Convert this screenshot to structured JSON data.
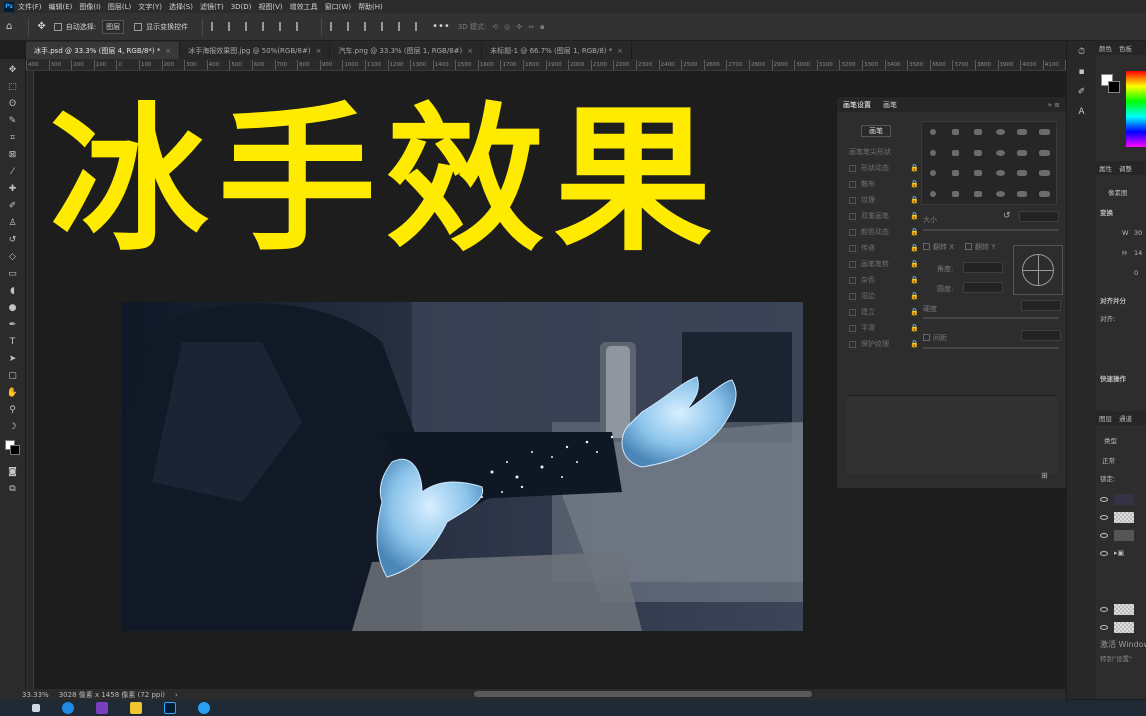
{
  "app": {
    "logo_text": "Ps"
  },
  "menu": [
    "文件(F)",
    "编辑(E)",
    "图像(I)",
    "图层(L)",
    "文字(Y)",
    "选择(S)",
    "滤镜(T)",
    "3D(D)",
    "视图(V)",
    "增效工具",
    "窗口(W)",
    "帮助(H)"
  ],
  "options_bar": {
    "auto_select_label": "自动选择:",
    "auto_select_value": "图层",
    "show_transform_label": "显示变换控件",
    "mode_label": "3D 模式:"
  },
  "tabs": [
    {
      "label": "冰手.psd @ 33.3% (图层 4, RGB/8*) *",
      "active": true
    },
    {
      "label": "冰手海报效果图.jpg @ 50%(RGB/8#)",
      "active": false
    },
    {
      "label": "汽车.png @ 33.3% (图层 1, RGB/8#)",
      "active": false
    },
    {
      "label": "未标题-1 @ 66.7% (图层 1, RGB/8) *",
      "active": false
    }
  ],
  "ruler_ticks": [
    "400",
    "300",
    "200",
    "100",
    "0",
    "100",
    "200",
    "300",
    "400",
    "500",
    "600",
    "700",
    "800",
    "900",
    "1000",
    "1100",
    "1200",
    "1300",
    "1400",
    "1500",
    "1600",
    "1700",
    "1800",
    "1900",
    "2000",
    "2100",
    "2200",
    "2300",
    "2400",
    "2500",
    "2600",
    "2700",
    "2800",
    "2900",
    "3000",
    "3100",
    "3200",
    "3300",
    "3400",
    "3500",
    "3600",
    "3700",
    "3800",
    "3900",
    "4000",
    "4100",
    "4200",
    "4300",
    "4400"
  ],
  "canvas": {
    "title": "冰手效果"
  },
  "brush_panel": {
    "tab_settings": "画笔设置",
    "tab_brushes": "画笔",
    "brush_button": "画笔",
    "tip_shape": "画笔笔尖形状",
    "options": [
      "形状动态",
      "散布",
      "纹理",
      "双重画笔",
      "颜色动态",
      "传递",
      "画笔笔势",
      "杂色",
      "湿边",
      "建立",
      "平滑",
      "保护纹理"
    ],
    "size_label": "大小",
    "flip_x": "翻转 X",
    "flip_y": "翻转 Y",
    "angle_label": "角度:",
    "roundness_label": "圆度:",
    "hardness_label": "硬度",
    "spacing_label": "间距"
  },
  "right_panel": {
    "color_tabs": [
      "颜色",
      "色板"
    ],
    "props_tabs": [
      "属性",
      "调整"
    ],
    "pixel_layer": "像素图",
    "transform": "变换",
    "w_label": "W",
    "w_value": "30",
    "h_label": "H",
    "h_value": "14",
    "angle_value": "0",
    "align_title": "对齐并分",
    "align_label": "对齐:",
    "quick_actions": "快速操作",
    "layers_tabs": [
      "图层",
      "通道"
    ],
    "kind_label": "类型",
    "blend_mode": "正常",
    "lock_label": "锁定:",
    "watermark": "激活 Windows",
    "watermark2": "转到\"设置\""
  },
  "status": {
    "zoom": "33.33%",
    "doc_size": "3028 像素 x 1458 像素 (72 ppi)"
  },
  "colors": {
    "title_yellow": "#ffeb00",
    "ps_blue": "#31a8ff"
  }
}
